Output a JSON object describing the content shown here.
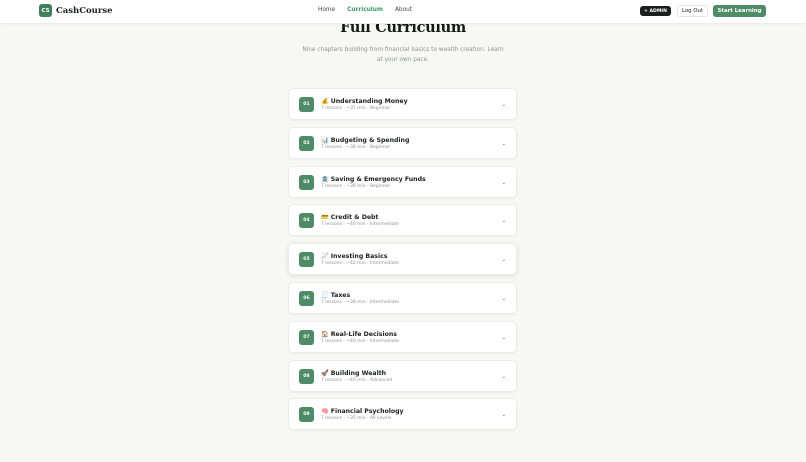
{
  "header": {
    "logo_mark": "CS",
    "brand": "CashCourse",
    "nav": [
      {
        "label": "Home",
        "name": "nav-home",
        "active": false
      },
      {
        "label": "Curriculum",
        "name": "nav-curriculum",
        "active": true
      },
      {
        "label": "About",
        "name": "nav-about",
        "active": false
      }
    ],
    "admin_label": "+ ADMIN",
    "logout_label": "Log Out",
    "start_label": "Start Learning"
  },
  "hero": {
    "title": "Full Curriculum",
    "subtitle": "Nine chapters building from financial basics to wealth creation. Learn at your own pace."
  },
  "chapters": [
    {
      "num": "01",
      "icon": "💰",
      "title": "Understanding Money",
      "meta": "7 lessons · ~35 min · Beginner"
    },
    {
      "num": "02",
      "icon": "📊",
      "title": "Budgeting & Spending",
      "meta": "7 lessons · ~38 min · Beginner"
    },
    {
      "num": "03",
      "icon": "🏦",
      "title": "Saving & Emergency Funds",
      "meta": "7 lessons · ~36 min · Beginner"
    },
    {
      "num": "04",
      "icon": "💳",
      "title": "Credit & Debt",
      "meta": "7 lessons · ~40 min · Intermediate"
    },
    {
      "num": "05",
      "icon": "📈",
      "title": "Investing Basics",
      "meta": "7 lessons · ~42 min · Intermediate"
    },
    {
      "num": "06",
      "icon": "🧾",
      "title": "Taxes",
      "meta": "7 lessons · ~38 min · Intermediate"
    },
    {
      "num": "07",
      "icon": "🏠",
      "title": "Real-Life Decisions",
      "meta": "7 lessons · ~40 min · Intermediate"
    },
    {
      "num": "08",
      "icon": "🚀",
      "title": "Building Wealth",
      "meta": "7 lessons · ~40 min · Advanced"
    },
    {
      "num": "09",
      "icon": "🧠",
      "title": "Financial Psychology",
      "meta": "7 lessons · ~35 min · All Levels"
    }
  ],
  "chevron_glyph": "⌄",
  "colors": {
    "accent": "#4d8c66",
    "nav_active": "#3f9a66",
    "admin_bg": "#1c1f1d"
  }
}
